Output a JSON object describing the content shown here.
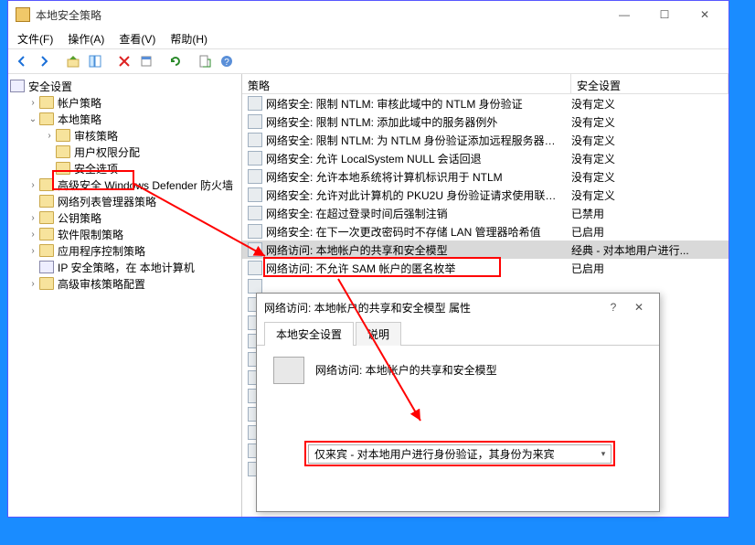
{
  "window": {
    "title": "本地安全策略",
    "menus": [
      "文件(F)",
      "操作(A)",
      "查看(V)",
      "帮助(H)"
    ]
  },
  "tree": {
    "root": "安全设置",
    "items": [
      {
        "label": "帐户策略",
        "depth": 1,
        "exp": ">"
      },
      {
        "label": "本地策略",
        "depth": 1,
        "exp": "v"
      },
      {
        "label": "审核策略",
        "depth": 2,
        "exp": ">"
      },
      {
        "label": "用户权限分配",
        "depth": 2,
        "exp": ""
      },
      {
        "label": "安全选项",
        "depth": 2,
        "exp": "",
        "highlight": true
      },
      {
        "label": "高级安全 Windows Defender 防火墙",
        "depth": 1,
        "exp": ">"
      },
      {
        "label": "网络列表管理器策略",
        "depth": 1,
        "exp": ""
      },
      {
        "label": "公钥策略",
        "depth": 1,
        "exp": ">"
      },
      {
        "label": "软件限制策略",
        "depth": 1,
        "exp": ">"
      },
      {
        "label": "应用程序控制策略",
        "depth": 1,
        "exp": ">"
      },
      {
        "label": "IP 安全策略，在 本地计算机",
        "depth": 1,
        "exp": "",
        "ip": true
      },
      {
        "label": "高级审核策略配置",
        "depth": 1,
        "exp": ">"
      }
    ]
  },
  "list": {
    "headers": {
      "policy": "策略",
      "setting": "安全设置"
    },
    "rows": [
      {
        "policy": "网络安全: 限制 NTLM: 审核此域中的 NTLM 身份验证",
        "setting": "没有定义"
      },
      {
        "policy": "网络安全: 限制 NTLM: 添加此域中的服务器例外",
        "setting": "没有定义"
      },
      {
        "policy": "网络安全: 限制 NTLM: 为 NTLM 身份验证添加远程服务器…",
        "setting": "没有定义"
      },
      {
        "policy": "网络安全: 允许 LocalSystem NULL 会话回退",
        "setting": "没有定义"
      },
      {
        "policy": "网络安全: 允许本地系统将计算机标识用于 NTLM",
        "setting": "没有定义"
      },
      {
        "policy": "网络安全: 允许对此计算机的 PKU2U 身份验证请求使用联…",
        "setting": "没有定义"
      },
      {
        "policy": "网络安全: 在超过登录时间后强制注销",
        "setting": "已禁用"
      },
      {
        "policy": "网络安全: 在下一次更改密码时不存储 LAN 管理器哈希值",
        "setting": "已启用"
      },
      {
        "policy": "网络访问: 本地帐户的共享和安全模型",
        "setting": "经典 - 对本地用户进行...",
        "selected": true
      },
      {
        "policy": "网络访问: 不允许 SAM 帐户的匿名枚举",
        "setting": "已启用"
      }
    ]
  },
  "dialog": {
    "title": "网络访问: 本地帐户的共享和安全模型 属性",
    "tabs": {
      "local": "本地安全设置",
      "explain": "说明"
    },
    "label": "网络访问: 本地帐户的共享和安全模型",
    "combo_value": "仅来宾 - 对本地用户进行身份验证，其身份为来宾"
  }
}
